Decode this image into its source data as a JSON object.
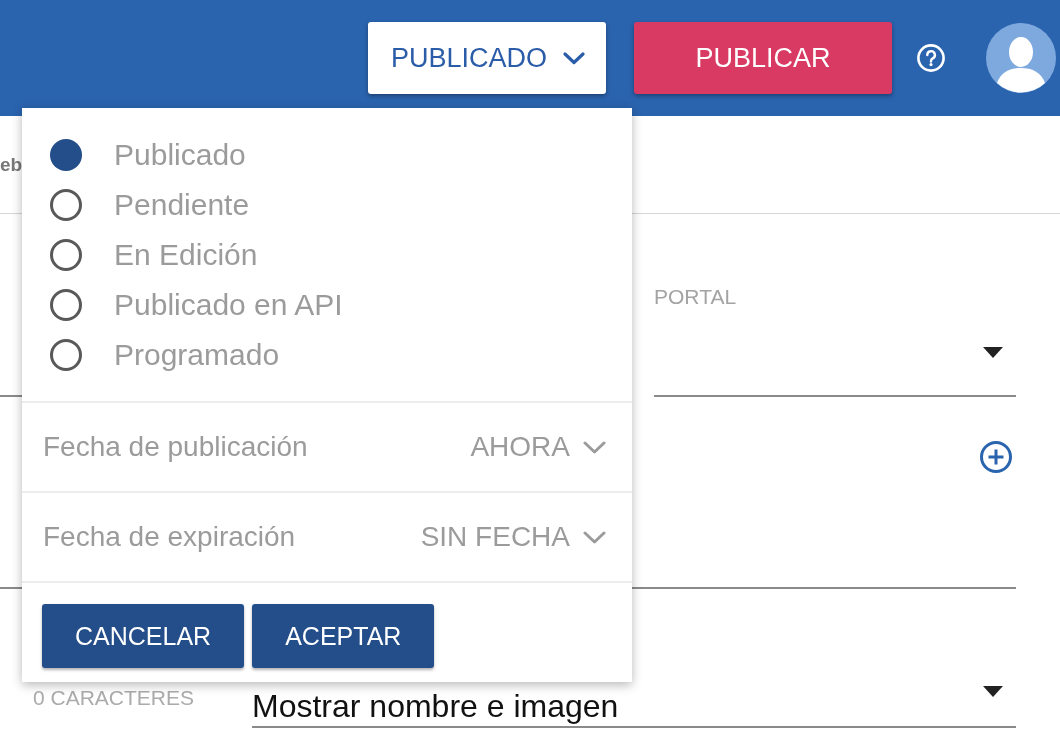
{
  "header": {
    "status_button": {
      "label": "PUBLICADO",
      "expanded": true
    },
    "publish_button": {
      "label": "PUBLICAR"
    }
  },
  "status_menu": {
    "options": [
      {
        "label": "Publicado",
        "selected": true
      },
      {
        "label": "Pendiente",
        "selected": false
      },
      {
        "label": "En Edición",
        "selected": false
      },
      {
        "label": "Publicado en API",
        "selected": false
      },
      {
        "label": "Programado",
        "selected": false
      }
    ],
    "date_rows": [
      {
        "label": "Fecha de publicación",
        "value": "AHORA"
      },
      {
        "label": "Fecha de expiración",
        "value": "SIN FECHA"
      }
    ],
    "buttons": [
      "CANCELAR",
      "ACEPTAR"
    ]
  },
  "tab_fragment": {
    "label": "eb"
  },
  "form": {
    "portal_select": {
      "label": "PORTAL"
    },
    "character_count": "0 CARACTERES",
    "display_select": {
      "value": "Mostrar nombre e imagen"
    }
  }
}
